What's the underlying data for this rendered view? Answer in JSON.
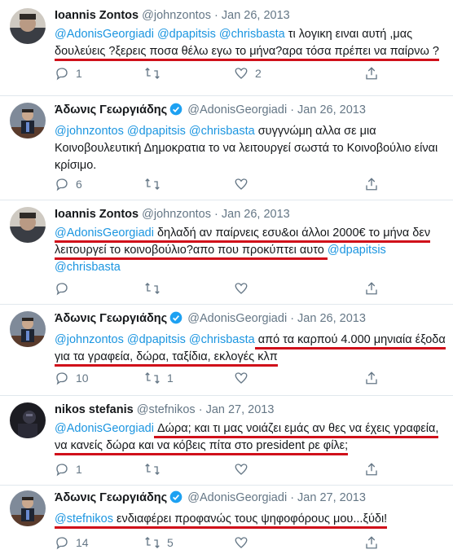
{
  "tweets": [
    {
      "name": "Ioannis Zontos",
      "handle": "@johnzontos",
      "date": "· Jan 26, 2013",
      "verified": false,
      "lines": [
        {
          "pre": "",
          "mentions": "@AdonisGeorgiadi @dpapitsis @chrisbasta",
          "text": " τι λογικη ειναι αυτή ,μας"
        },
        {
          "pre": "",
          "mentions": "",
          "text": "δουλεύεις ?ξερεις ποσα θέλω εγω το μήνα?αρα τόσα πρέπει να παίρνω ?"
        }
      ],
      "replies": "1",
      "retweets": "",
      "likes": "2"
    },
    {
      "name": "Άδωνις Γεωργιάδης",
      "handle": "@AdonisGeorgiadi",
      "date": "· Jan 26, 2013",
      "verified": true,
      "lines": [
        {
          "pre": "",
          "mentions": "@johnzontos @dpapitsis @chrisbasta",
          "text": " συγγνώμη αλλα σε μια"
        },
        {
          "pre": "",
          "mentions": "",
          "text": "Κοινοβουλευτική Δημοκρατια το να λειτουργεί σωστά το Κοινοβούλιο είναι"
        },
        {
          "pre": "",
          "mentions": "",
          "text": "κρίσιμο."
        }
      ],
      "replies": "6",
      "retweets": "",
      "likes": ""
    },
    {
      "name": "Ioannis Zontos",
      "handle": "@johnzontos",
      "date": "· Jan 26, 2013",
      "verified": false,
      "lines": [
        {
          "mentions": "@AdonisGeorgiadi",
          "text": " δηλαδή αν παίρνεις εσυ&οι άλλοι 2000€ το μήνα δεν"
        },
        {
          "mentions": "",
          "text": "λειτουργεί το κοινοβούλιο?απο που προκύπτει αυτο ",
          "tail": "@dpapitsis"
        },
        {
          "mentions": "@chrisbasta",
          "text": ""
        }
      ],
      "replies": "",
      "retweets": "",
      "likes": ""
    },
    {
      "name": "Άδωνις Γεωργιάδης",
      "handle": "@AdonisGeorgiadi",
      "date": "· Jan 26, 2013",
      "verified": true,
      "lines": [
        {
          "mentions": "@johnzontos @dpapitsis @chrisbasta",
          "text": " από τα καρπού 4.000 μηνιαία έξοδα"
        },
        {
          "mentions": "",
          "text": "για τα γραφεία, δώρα, ταξίδια, εκλογές κλπ"
        }
      ],
      "replies": "10",
      "retweets": "1",
      "likes": ""
    },
    {
      "name": "nikos stefanis",
      "handle": "@stefnikos",
      "date": "· Jan 27, 2013",
      "verified": false,
      "lines": [
        {
          "mentions": "@AdonisGeorgiadi",
          "text": " Δώρα; και τι μας νοιάζει εμάς αν θες να έχεις γραφεία,"
        },
        {
          "mentions": "",
          "text": "να κανείς δώρα και να κόβεις πίτα στο president ρε φίλε;"
        }
      ],
      "replies": "1",
      "retweets": "",
      "likes": ""
    },
    {
      "name": "Άδωνις Γεωργιάδης",
      "handle": "@AdonisGeorgiadi",
      "date": "· Jan 27, 2013",
      "verified": true,
      "lines": [
        {
          "mentions": "@stefnikos",
          "text": " ενδιαφέρει προφανώς τους ψηφοφόρους μου...ξύδι!"
        }
      ],
      "replies": "14",
      "retweets": "5",
      "likes": ""
    }
  ],
  "colors": {
    "mention": "#1b95e0",
    "underline": "#d0101a",
    "muted": "#657786",
    "verified": "#1da1f2"
  },
  "icons": [
    "reply-icon",
    "retweet-icon",
    "like-icon",
    "share-icon",
    "verified-badge-icon"
  ]
}
